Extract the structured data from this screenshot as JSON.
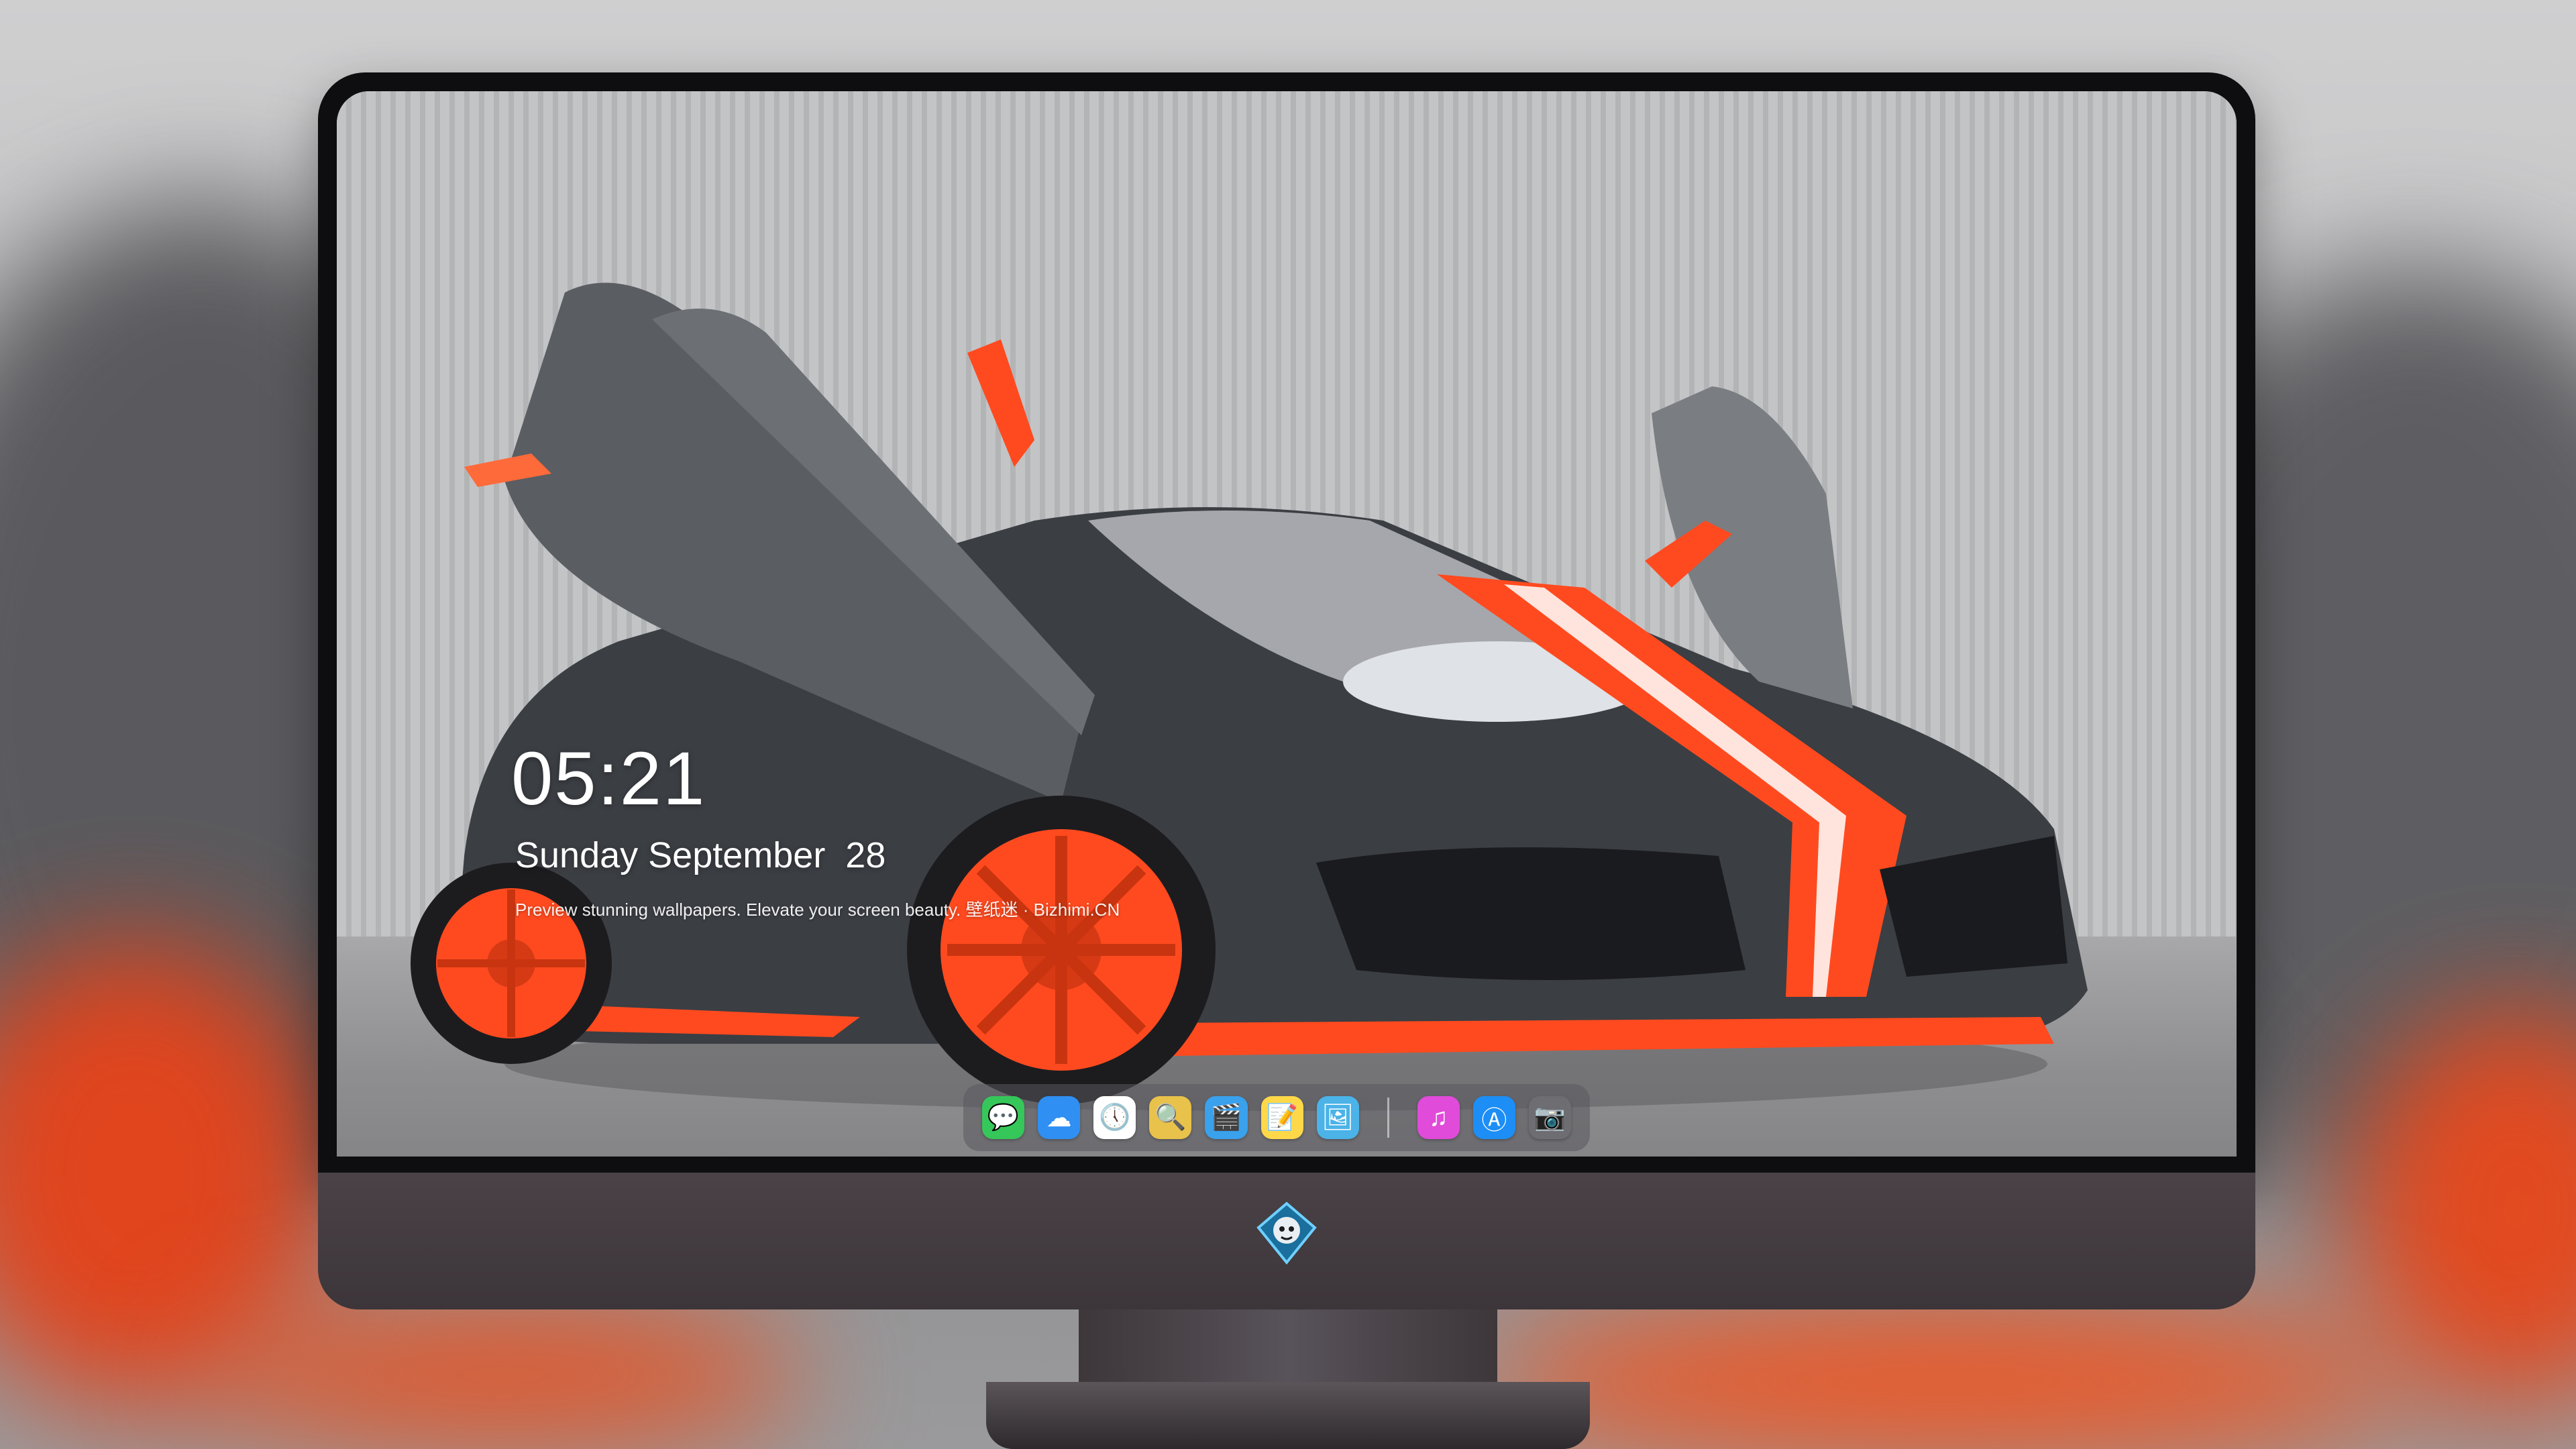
{
  "lockscreen": {
    "time": "05:21",
    "date": "Sunday September  28",
    "tagline": "Preview stunning wallpapers. Elevate your screen beauty. 壁纸迷 · Bizhimi.CN"
  },
  "dock": {
    "apps": [
      {
        "name": "messages-icon",
        "glyph": "💬",
        "color": "#35c759"
      },
      {
        "name": "weather-icon",
        "glyph": "☁",
        "color": "#2f8ff2"
      },
      {
        "name": "clock-icon",
        "glyph": "🕔",
        "color": "#ffffff"
      },
      {
        "name": "preview-icon",
        "glyph": "🔍",
        "color": "#e8c24a"
      },
      {
        "name": "final-cut-icon",
        "glyph": "🎬",
        "color": "#3aa1ec"
      },
      {
        "name": "notes-icon",
        "glyph": "📝",
        "color": "#ffd84a"
      },
      {
        "name": "photos-icon",
        "glyph": "🖼",
        "color": "#4bb3e8"
      }
    ],
    "apps_after_separator": [
      {
        "name": "itunes-icon",
        "glyph": "♫",
        "color": "#e04bd9"
      },
      {
        "name": "app-store-icon",
        "glyph": "Ⓐ",
        "color": "#1c8ef5"
      },
      {
        "name": "camera-icon",
        "glyph": "📷",
        "color": "#6e6e72"
      }
    ]
  },
  "colors": {
    "accent_orange": "#ff4a1f",
    "car_body": "#3c3f44",
    "bezel": "#0e0e10",
    "chin": "#423b3f"
  },
  "wallpaper": {
    "subject": "matte-grey sports car with orange wheels and stripe, scissor doors open"
  }
}
